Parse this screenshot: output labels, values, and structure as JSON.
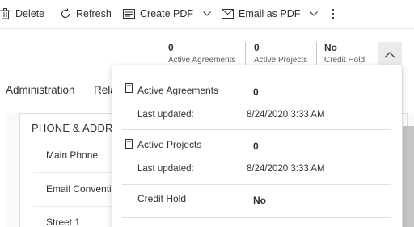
{
  "toolbar": {
    "delete_label": "Delete",
    "refresh_label": "Refresh",
    "create_pdf_label": "Create PDF",
    "email_pdf_label": "Email as PDF",
    "more_icon": "more-vertical-icon"
  },
  "header": {
    "fields": [
      {
        "value": "0",
        "label": "Active Agreements"
      },
      {
        "value": "0",
        "label": "Active Projects"
      },
      {
        "value": "No",
        "label": "Credit Hold"
      }
    ],
    "toggle_icon": "chevron-up-icon"
  },
  "tabs": [
    {
      "label": "Administration"
    },
    {
      "label": "Rela"
    }
  ],
  "form": {
    "section_title": "PHONE & ADDR",
    "fields": [
      {
        "label": "Main Phone"
      },
      {
        "label": "Email Conventio"
      },
      {
        "label": "Street 1"
      }
    ]
  },
  "flyout": {
    "active_agreements": {
      "name": "Active Agreements",
      "value": "0",
      "updated_label": "Last updated:",
      "updated": "8/24/2020 3:33 AM"
    },
    "active_projects": {
      "name": "Active Projects",
      "value": "0",
      "updated_label": "Last updated:",
      "updated": "8/24/2020 3:33 AM"
    },
    "credit_hold": {
      "name": "Credit Hold",
      "value": "No"
    }
  },
  "colors": {
    "text": "#323130",
    "muted": "#605e5c",
    "divider": "#e1dfdd",
    "toggle_bg": "#edebe9"
  }
}
